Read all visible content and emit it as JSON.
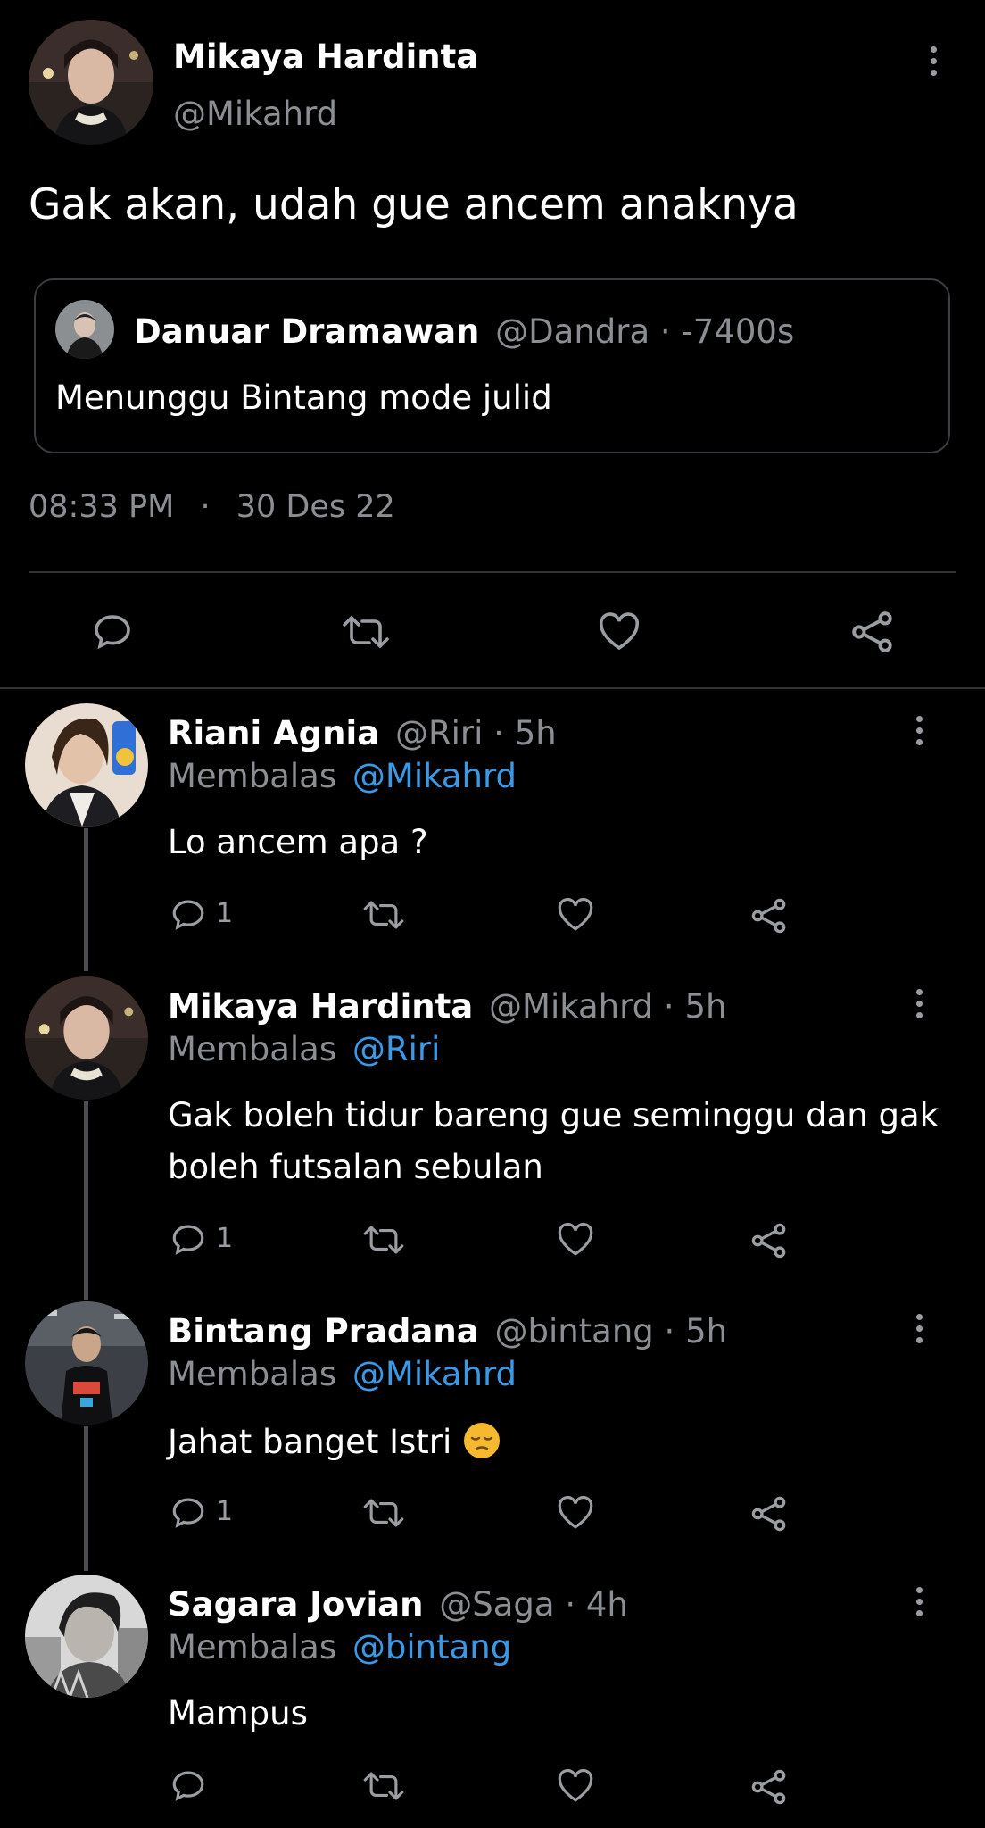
{
  "main_tweet": {
    "name": "Mikaya Hardinta",
    "handle": "@Mikahrd",
    "text": "Gak akan, udah gue ancem anaknya",
    "quote": {
      "name": "Danuar Dramawan",
      "meta": "@Dandra · -7400s",
      "text": "Menunggu Bintang mode julid"
    },
    "time": "08:33 PM",
    "date": "30 Des 22"
  },
  "replies": [
    {
      "name": "Riani Agnia",
      "meta": "@Riri · 5h",
      "replying_label": "Membalas",
      "replying_to": "@Mikahrd",
      "text": "Lo ancem apa ?",
      "reply_count": "1"
    },
    {
      "name": "Mikaya Hardinta",
      "meta": "@Mikahrd · 5h",
      "replying_label": "Membalas",
      "replying_to": "@Riri",
      "text_line1": "Gak boleh tidur bareng gue seminggu dan gak",
      "text_line2": "boleh futsalan sebulan",
      "reply_count": "1"
    },
    {
      "name": "Bintang Pradana",
      "meta": "@bintang · 5h",
      "replying_label": "Membalas",
      "replying_to": "@Mikahrd",
      "text": "Jahat banget Istri",
      "emoji": "pensive-face",
      "reply_count": "1"
    },
    {
      "name": "Sagara Jovian",
      "meta": "@Saga · 4h",
      "replying_label": "Membalas",
      "replying_to": "@bintang",
      "text": "Mampus",
      "reply_count": ""
    }
  ],
  "colors": {
    "link": "#3b9ae8",
    "muted": "#8b8f94",
    "background": "#000000",
    "emoji": "#f5b82e"
  }
}
